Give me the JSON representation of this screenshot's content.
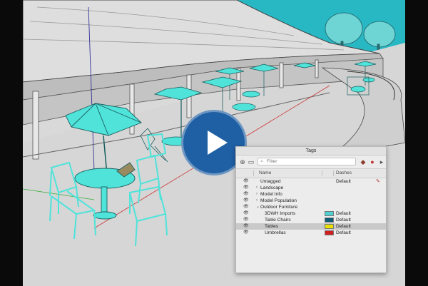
{
  "tags_panel": {
    "title": "Tags",
    "filter_placeholder": "Filter",
    "columns": {
      "name": "Name",
      "dashes": "Dashes"
    },
    "rows": [
      {
        "name": "Untagged",
        "indent": 0,
        "chevron": "",
        "color": "",
        "dashes": "Default",
        "selected": false,
        "editing_icon": true
      },
      {
        "name": "Landscape",
        "indent": 0,
        "chevron": "›",
        "color": "",
        "dashes": "",
        "selected": false,
        "editing_icon": false
      },
      {
        "name": "Model Info",
        "indent": 0,
        "chevron": "›",
        "color": "",
        "dashes": "",
        "selected": false,
        "editing_icon": false
      },
      {
        "name": "Model Population",
        "indent": 0,
        "chevron": "›",
        "color": "",
        "dashes": "",
        "selected": false,
        "editing_icon": false
      },
      {
        "name": "Outdoor Furniture",
        "indent": 0,
        "chevron": "⌄",
        "color": "",
        "dashes": "",
        "selected": false,
        "editing_icon": false
      },
      {
        "name": "3DWH Imports",
        "indent": 1,
        "chevron": "",
        "color": "#4fd1d1",
        "dashes": "Default",
        "selected": false,
        "editing_icon": false
      },
      {
        "name": "Table Chairs",
        "indent": 1,
        "chevron": "",
        "color": "#0c5a74",
        "dashes": "Default",
        "selected": false,
        "editing_icon": false
      },
      {
        "name": "Tables",
        "indent": 1,
        "chevron": "",
        "color": "#e8e000",
        "dashes": "Default",
        "selected": true,
        "editing_icon": false
      },
      {
        "name": "Umbrellas",
        "indent": 1,
        "chevron": "",
        "color": "#cf2020",
        "dashes": "Default",
        "selected": false,
        "editing_icon": false
      }
    ]
  },
  "icons": {
    "visibility": "eye-icon",
    "add_tag": "add-tag-icon",
    "add_folder": "folder-icon",
    "search": "search-icon",
    "paint": "paint-icon",
    "delete": "delete-tag-icon",
    "details": "details-icon",
    "play": "play-icon"
  },
  "colors": {
    "play_button": "#1f5fa4",
    "model_cyan": "#4fe3da",
    "sky": "#27b8c4"
  }
}
